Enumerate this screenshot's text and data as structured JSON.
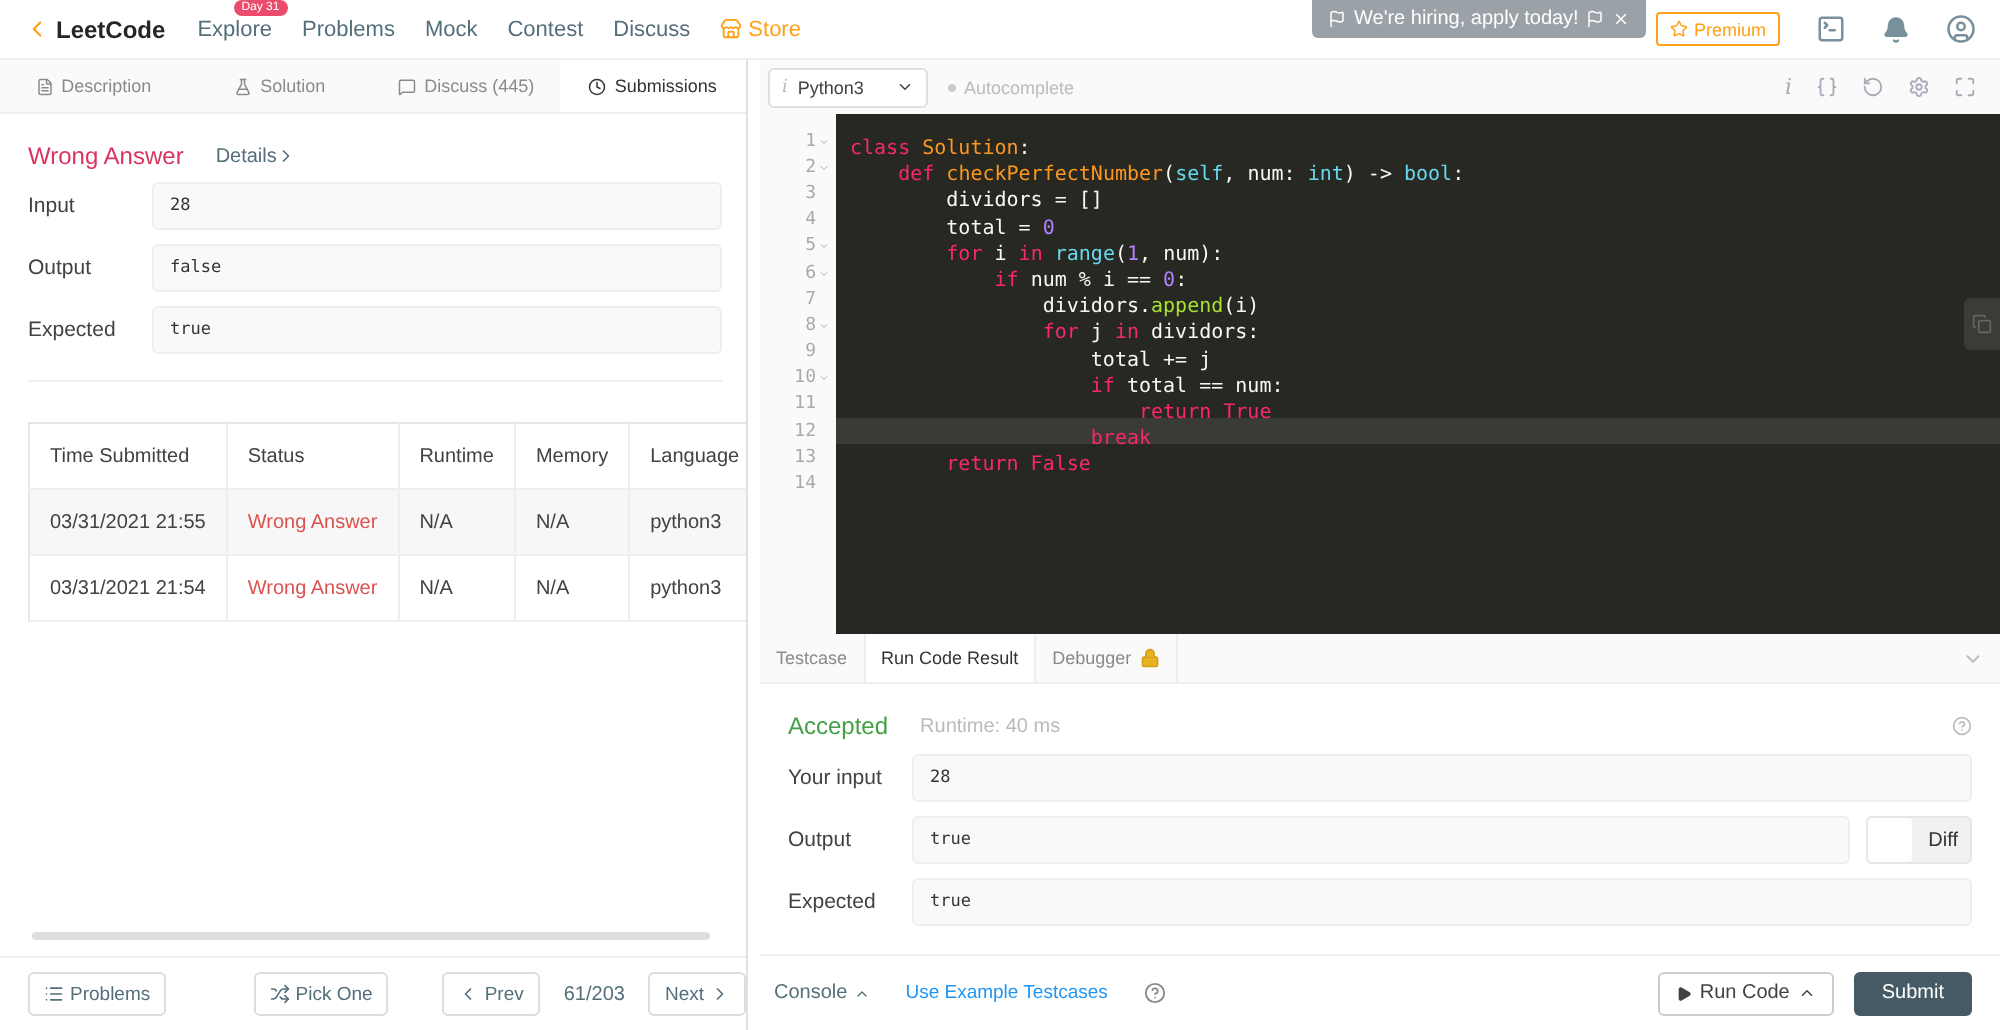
{
  "nav": {
    "logo": "LeetCode",
    "links": [
      {
        "label": "Explore",
        "badge": "Day 31",
        "kind": "link"
      },
      {
        "label": "Problems",
        "kind": "link"
      },
      {
        "label": "Mock",
        "kind": "link"
      },
      {
        "label": "Contest",
        "kind": "link"
      },
      {
        "label": "Discuss",
        "kind": "link"
      },
      {
        "label": "Store",
        "kind": "store"
      }
    ],
    "banner": "We're hiring, apply today!",
    "premium": "Premium"
  },
  "left_tabs": [
    {
      "label": "Description",
      "selected": false
    },
    {
      "label": "Solution",
      "selected": false
    },
    {
      "label": "Discuss (445)",
      "selected": false
    },
    {
      "label": "Submissions",
      "selected": true
    }
  ],
  "submission": {
    "status": "Wrong Answer",
    "details": "Details",
    "fields": [
      {
        "label": "Input",
        "value": "28"
      },
      {
        "label": "Output",
        "value": "false"
      },
      {
        "label": "Expected",
        "value": "true"
      }
    ]
  },
  "table": {
    "columns": [
      "Time Submitted",
      "Status",
      "Runtime",
      "Memory",
      "Language"
    ],
    "rows": [
      {
        "time": "03/31/2021 21:55",
        "status": "Wrong Answer",
        "runtime": "N/A",
        "memory": "N/A",
        "language": "python3"
      },
      {
        "time": "03/31/2021 21:54",
        "status": "Wrong Answer",
        "runtime": "N/A",
        "memory": "N/A",
        "language": "python3"
      }
    ]
  },
  "pager": {
    "problems": "Problems",
    "pick": "Pick One",
    "prev": "Prev",
    "counter": "61/203",
    "next": "Next"
  },
  "editor": {
    "language_mark": "i",
    "language": "Python3",
    "autocomplete": "Autocomplete",
    "info": "i",
    "lines": [
      {
        "number": "1",
        "foldable": true,
        "active": false,
        "tokens": [
          {
            "t": "class ",
            "kind": "kw"
          },
          {
            "t": "Solution",
            "kind": "name"
          },
          {
            "t": ":",
            "kind": "plain"
          }
        ]
      },
      {
        "number": "2",
        "foldable": true,
        "active": false,
        "tokens": [
          {
            "t": "    def ",
            "kind": "kw"
          },
          {
            "t": "checkPerfectNumber",
            "kind": "name"
          },
          {
            "t": "(",
            "kind": "plain"
          },
          {
            "t": "self",
            "kind": "builtin"
          },
          {
            "t": ", num: ",
            "kind": "plain"
          },
          {
            "t": "int",
            "kind": "builtin"
          },
          {
            "t": ") -> ",
            "kind": "plain"
          },
          {
            "t": "bool",
            "kind": "builtin"
          },
          {
            "t": ":",
            "kind": "plain"
          }
        ]
      },
      {
        "number": "3",
        "foldable": false,
        "active": false,
        "tokens": [
          {
            "t": "        dividors = []",
            "kind": "plain"
          }
        ]
      },
      {
        "number": "4",
        "foldable": false,
        "active": false,
        "tokens": [
          {
            "t": "        total = ",
            "kind": "plain"
          },
          {
            "t": "0",
            "kind": "num"
          }
        ]
      },
      {
        "number": "5",
        "foldable": true,
        "active": false,
        "tokens": [
          {
            "t": "        for",
            "kind": "kw"
          },
          {
            "t": " i ",
            "kind": "plain"
          },
          {
            "t": "in",
            "kind": "kw"
          },
          {
            "t": " range",
            "kind": "builtin"
          },
          {
            "t": "(",
            "kind": "plain"
          },
          {
            "t": "1",
            "kind": "num"
          },
          {
            "t": ", num):",
            "kind": "plain"
          }
        ]
      },
      {
        "number": "6",
        "foldable": true,
        "active": false,
        "tokens": [
          {
            "t": "            if",
            "kind": "kw"
          },
          {
            "t": " num % i == ",
            "kind": "plain"
          },
          {
            "t": "0",
            "kind": "num"
          },
          {
            "t": ":",
            "kind": "plain"
          }
        ]
      },
      {
        "number": "7",
        "foldable": false,
        "active": false,
        "tokens": [
          {
            "t": "                dividors.",
            "kind": "plain"
          },
          {
            "t": "append",
            "kind": "fn"
          },
          {
            "t": "(i)",
            "kind": "plain"
          }
        ]
      },
      {
        "number": "8",
        "foldable": true,
        "active": false,
        "tokens": [
          {
            "t": "                for",
            "kind": "kw"
          },
          {
            "t": " j ",
            "kind": "plain"
          },
          {
            "t": "in",
            "kind": "kw"
          },
          {
            "t": " dividors:",
            "kind": "plain"
          }
        ]
      },
      {
        "number": "9",
        "foldable": false,
        "active": false,
        "tokens": [
          {
            "t": "                    total += j",
            "kind": "plain"
          }
        ]
      },
      {
        "number": "10",
        "foldable": true,
        "active": false,
        "tokens": [
          {
            "t": "                    if",
            "kind": "kw"
          },
          {
            "t": " total == num:",
            "kind": "plain"
          }
        ]
      },
      {
        "number": "11",
        "foldable": false,
        "active": false,
        "tokens": [
          {
            "t": "                        return True",
            "kind": "kw"
          }
        ]
      },
      {
        "number": "12",
        "foldable": false,
        "active": true,
        "tokens": [
          {
            "t": "                    break",
            "kind": "kw"
          }
        ]
      },
      {
        "number": "13",
        "foldable": false,
        "active": false,
        "tokens": [
          {
            "t": "        return False",
            "kind": "kw"
          }
        ]
      },
      {
        "number": "14",
        "foldable": false,
        "active": false
      }
    ]
  },
  "console_tabs": [
    {
      "label": "Testcase",
      "selected": false,
      "locked": false
    },
    {
      "label": "Run Code Result",
      "selected": true,
      "locked": false
    },
    {
      "label": "Debugger",
      "selected": false,
      "locked": true
    }
  ],
  "run_result": {
    "status": "Accepted",
    "runtime": "Runtime: 40 ms",
    "fields": [
      {
        "label": "Your input",
        "value": "28"
      },
      {
        "label": "Output",
        "value": "true",
        "diff": {
          "label": "Diff",
          "on": false
        }
      },
      {
        "label": "Expected",
        "value": "true"
      }
    ]
  },
  "actions": {
    "console": "Console",
    "example": "Use Example Testcases",
    "run": "Run Code",
    "submit": "Submit"
  }
}
